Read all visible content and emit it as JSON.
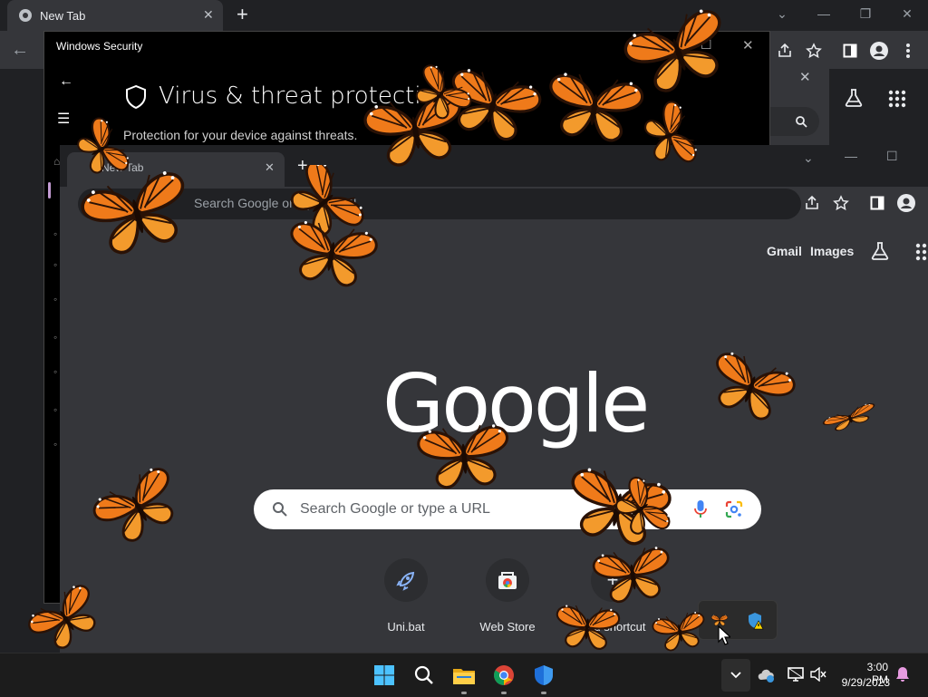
{
  "browser_back": {
    "tab_title": "New Tab",
    "new_tab_symbol": "+"
  },
  "windows_security": {
    "window_title": "Windows Security",
    "heading": "Virus & threat protection",
    "subtitle": "Protection for your device against threats."
  },
  "browser_front": {
    "tab_title": "New Tab",
    "omnibox_placeholder": "Search Google or type a URL",
    "header_links": [
      "Gmail",
      "Images"
    ],
    "logo_text": "Google",
    "search_placeholder": "Search Google or type a URL",
    "shortcuts": [
      {
        "label": "Uni.bat",
        "icon": "rocket-icon"
      },
      {
        "label": "Web Store",
        "icon": "webstore-icon"
      },
      {
        "label": "Add shortcut",
        "icon": "plus-icon"
      }
    ]
  },
  "taskbar": {
    "time": "3:00 PM",
    "date": "9/29/2023",
    "apps": [
      "windows-start-icon",
      "search-icon",
      "file-explorer-icon",
      "chrome-icon",
      "windows-security-icon"
    ]
  },
  "colors": {
    "taskbar_bg": "#1c1c1c",
    "chrome_dark": "#202124",
    "chrome_toolbar": "#35363a",
    "butterfly_orange": "#f07a1a",
    "butterfly_dark": "#2a1206"
  }
}
